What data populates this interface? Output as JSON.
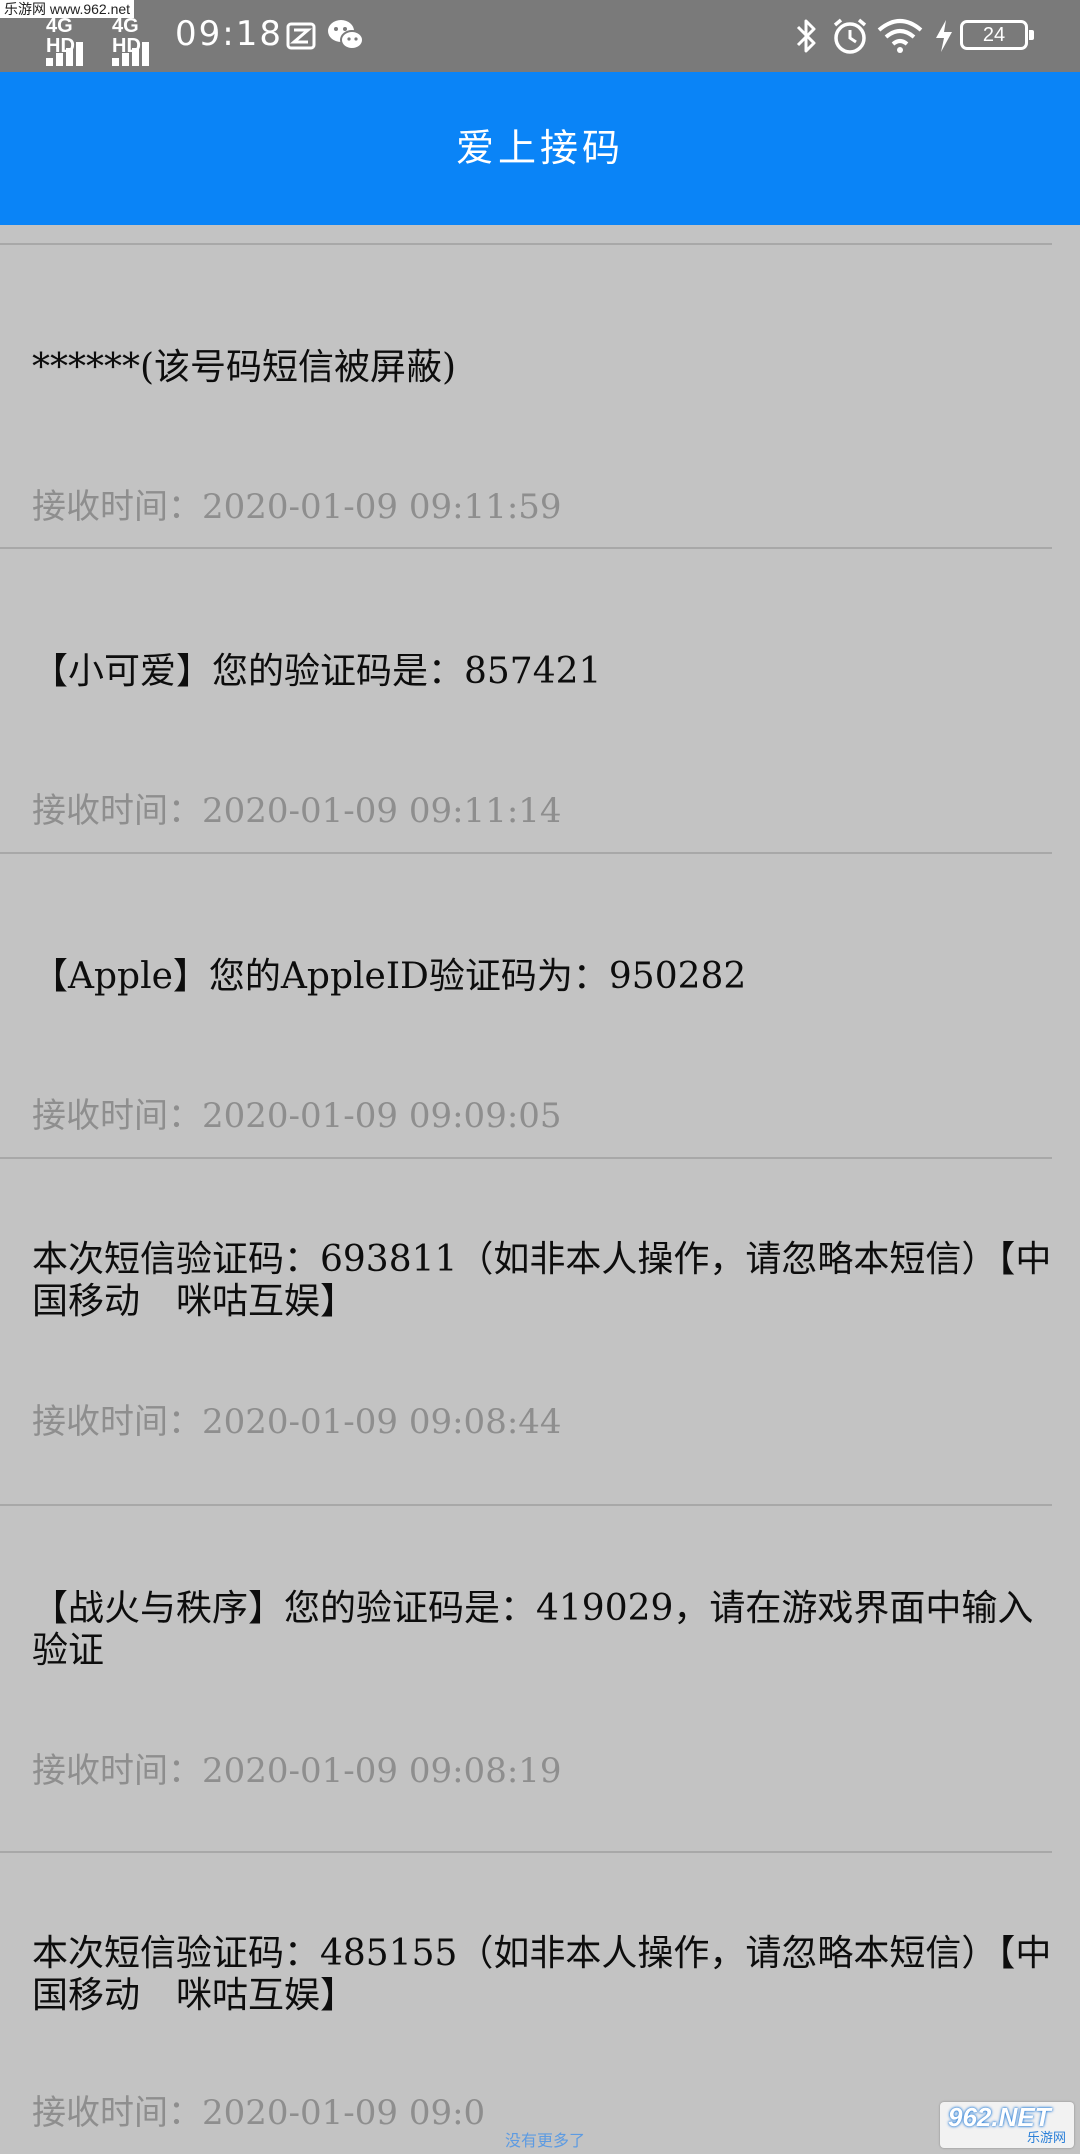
{
  "status_bar": {
    "watermark": "乐游网 www.962.net",
    "network_1": "4G HD",
    "network_2": "4G HD",
    "time": "09:18",
    "battery_level": "24",
    "icons": [
      "sim-signal-icon",
      "sim-signal-icon",
      "screenshot-icon",
      "wechat-icon",
      "bluetooth-icon",
      "alarm-icon",
      "wifi-icon",
      "charging-icon",
      "battery-icon"
    ]
  },
  "app_bar": {
    "title": "爱上接码",
    "color": "#0a84f7"
  },
  "messages": [
    {
      "text": "******(该号码短信被屏蔽)",
      "time": "接收时间：2020-01-09 09:11:59"
    },
    {
      "text": "【小可爱】您的验证码是：857421",
      "time": "接收时间：2020-01-09 09:11:14"
    },
    {
      "text": "【Apple】您的AppleID验证码为：950282",
      "time": "接收时间：2020-01-09 09:09:05"
    },
    {
      "text": "本次短信验证码：693811（如非本人操作，请忽略本短信）【中国移动　咪咕互娱】",
      "time": "接收时间：2020-01-09 09:08:44"
    },
    {
      "text": "【战火与秩序】您的验证码是：419029，请在游戏界面中输入验证",
      "time": "接收时间：2020-01-09 09:08:19"
    },
    {
      "text": "本次短信验证码：485155（如非本人操作，请忽略本短信）【中国移动　咪咕互娱】",
      "time": "接收时间：2020-01-09 09:0"
    }
  ],
  "watermark_bottom": {
    "logo": "962.NET",
    "sub": "乐游网"
  },
  "scroll_hint": "没有更多了"
}
